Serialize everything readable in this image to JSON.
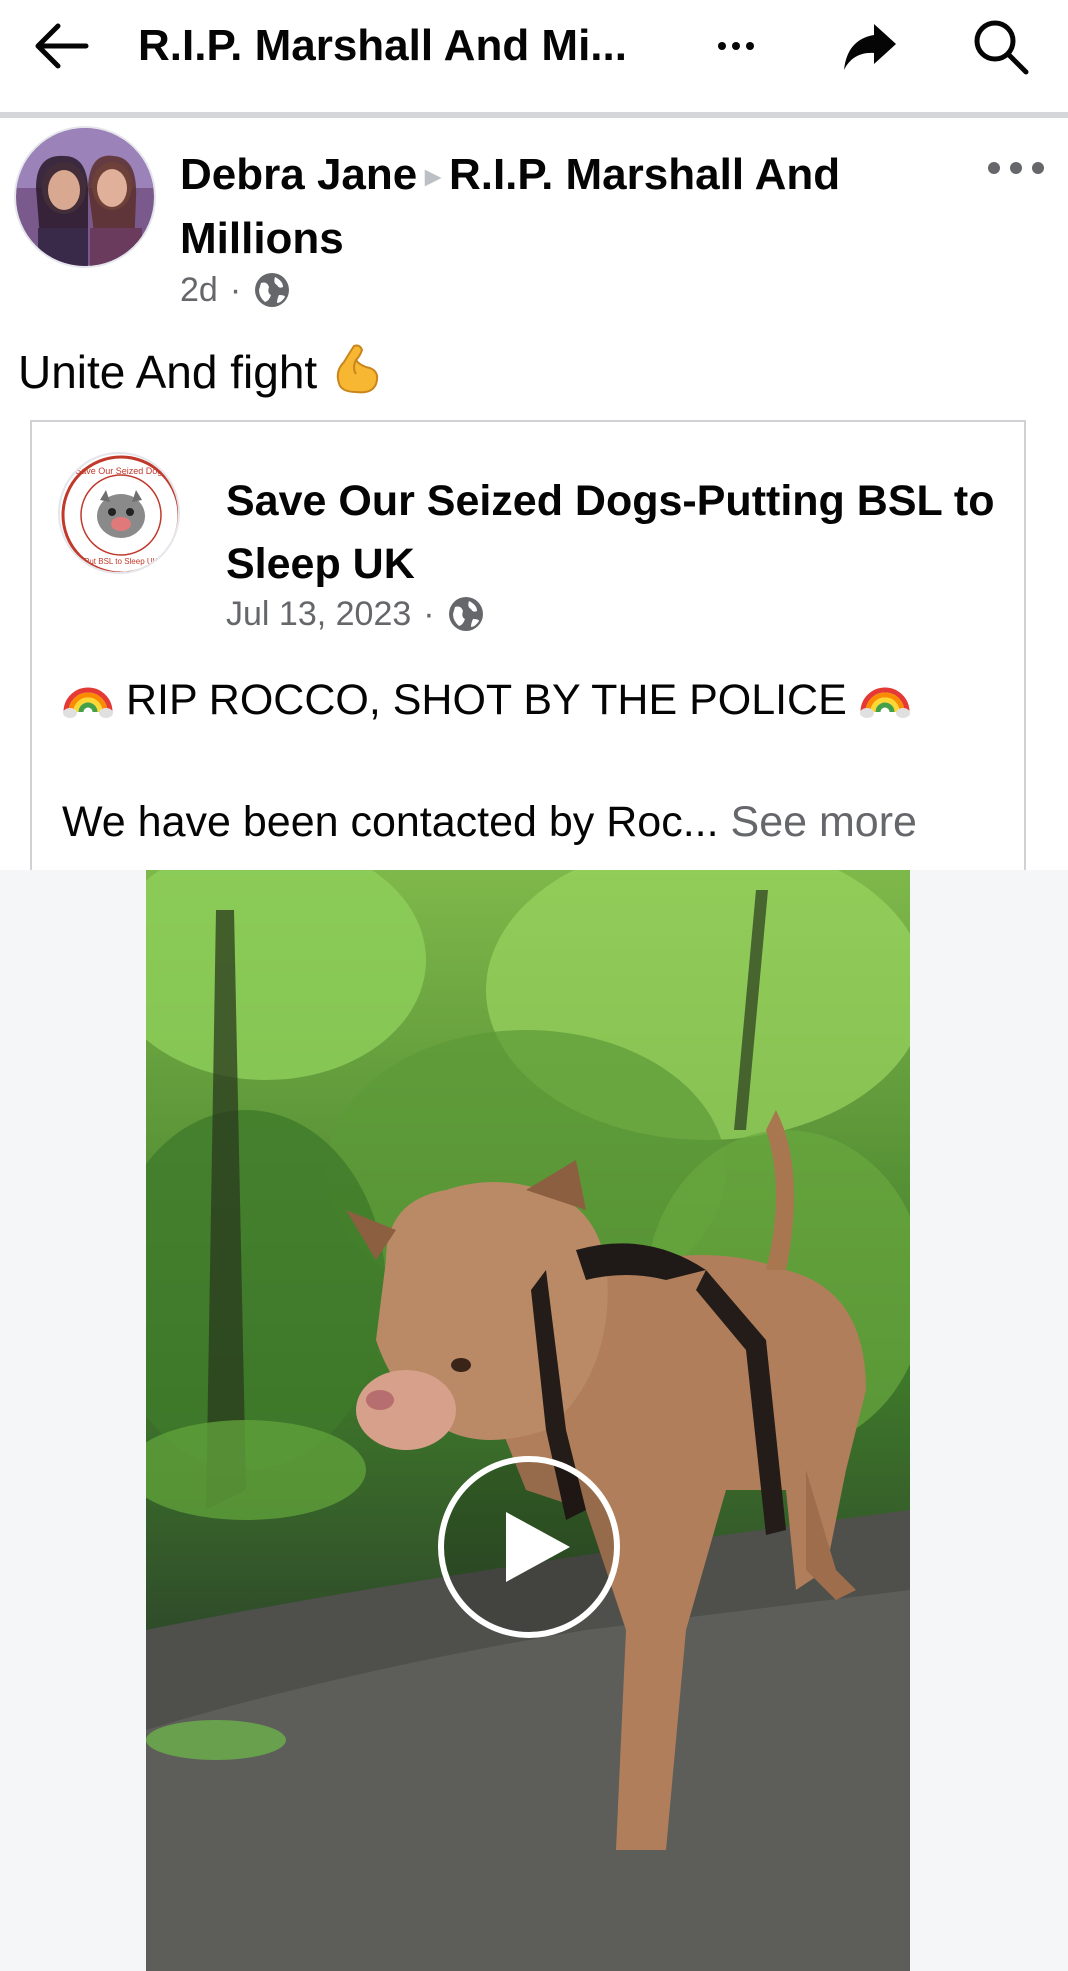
{
  "topbar": {
    "title": "R.I.P. Marshall And Mi...",
    "icons": [
      "back-arrow-icon",
      "more-icon",
      "share-icon",
      "search-icon"
    ]
  },
  "post": {
    "author": "Debra Jane",
    "group": "R.I.P. Marshall And Millions",
    "time": "2d",
    "separator": "·",
    "text": "Unite And fight",
    "text_emoji": "flexed-biceps"
  },
  "shared": {
    "page_name": "Save Our Seized Dogs-Putting BSL to Sleep UK",
    "date": "Jul 13, 2023",
    "separator": "·",
    "line1": "RIP ROCCO, SHOT BY THE POLICE",
    "line2": "We have been contacted by Roc...",
    "see_more": "See more",
    "avatar_text_top": "Save Our Seized Dogs",
    "avatar_text_bottom": "Put BSL to Sleep UK"
  },
  "video": {
    "subject": "dog walking on forest path",
    "play_icon": "play-icon"
  },
  "colors": {
    "text": "#050505",
    "secondary": "#65676b",
    "divider": "#d4d6da"
  }
}
